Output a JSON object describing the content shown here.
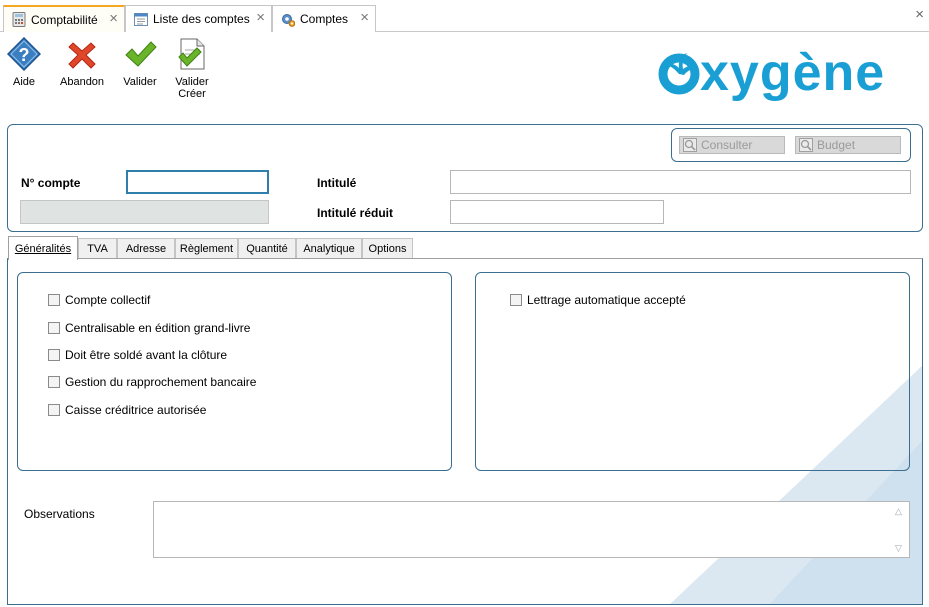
{
  "tabs": [
    {
      "label": "Comptabilité",
      "icon": "calculator-icon",
      "active": true
    },
    {
      "label": "Liste des comptes",
      "icon": "list-window-icon",
      "active": false
    },
    {
      "label": "Comptes",
      "icon": "gear-icon",
      "active": false
    }
  ],
  "toolbar": {
    "help_label": "Aide",
    "cancel_label": "Abandon",
    "validate_label": "Valider",
    "validate_create_label_1": "Valider",
    "validate_create_label_2": "Créer"
  },
  "logo": {
    "text": "oxygène",
    "color": "#1a9fd4"
  },
  "header": {
    "consult_label": "Consulter",
    "budget_label": "Budget",
    "account_number_label": "N° compte",
    "account_number_value": "",
    "title_label": "Intitulé",
    "title_value": "",
    "short_title_label": "Intitulé réduit",
    "short_title_value": ""
  },
  "form_tabs": [
    "Généralités",
    "TVA",
    "Adresse",
    "Règlement",
    "Quantité",
    "Analytique",
    "Options"
  ],
  "active_form_tab": "Généralités",
  "left_options": [
    {
      "label": "Compte collectif",
      "checked": false
    },
    {
      "label": "Centralisable en édition grand-livre",
      "checked": false
    },
    {
      "label": "Doit être soldé avant la clôture",
      "checked": false
    },
    {
      "label": "Gestion du rapprochement bancaire",
      "checked": false
    },
    {
      "label": "Caisse créditrice autorisée",
      "checked": false
    }
  ],
  "right_options": [
    {
      "label": "Lettrage automatique accepté",
      "checked": false
    }
  ],
  "observations": {
    "label": "Observations",
    "value": ""
  },
  "colors": {
    "accent_tab": "#f5a623",
    "panel_border": "#3b6e8f",
    "focus_border": "#2f7fad",
    "brand": "#1a9fd4"
  }
}
